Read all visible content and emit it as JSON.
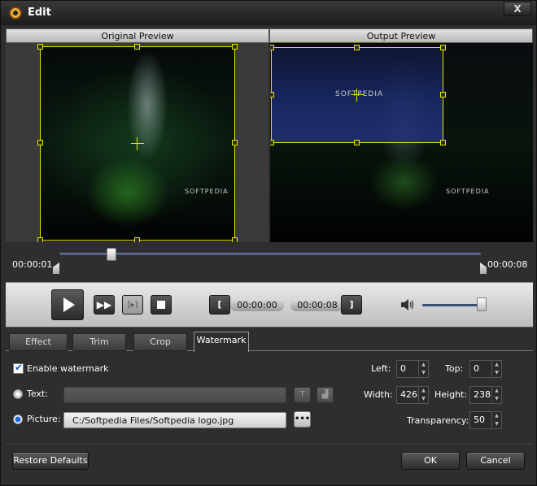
{
  "window": {
    "title": "Edit",
    "close_label": "X"
  },
  "preview": {
    "original_label": "Original Preview",
    "output_label": "Output Preview",
    "watermark_text": "SOFTPEDIA"
  },
  "timeline": {
    "start_time": "00:00:01",
    "end_time": "00:00:08",
    "position": 0.12
  },
  "controls": {
    "play_icon": "play-icon",
    "next_frame_icon": "fast-forward-icon",
    "trim_icon": "trim-icon",
    "stop_icon": "stop-icon",
    "mark_in_label": "[",
    "mark_out_label": "]",
    "start_time": "00:00:00",
    "end_time": "00:00:08",
    "volume": 0.95
  },
  "tabs": [
    {
      "label": "Effect"
    },
    {
      "label": "Trim"
    },
    {
      "label": "Crop"
    },
    {
      "label": "Watermark",
      "active": true
    }
  ],
  "watermark": {
    "enable_label": "Enable watermark",
    "enabled": true,
    "text_label": "Text:",
    "text_value": "",
    "picture_label": "Picture:",
    "picture_value": "C:/Softpedia Files/Softpedia logo.jpg",
    "browse_label": "•••",
    "left_label": "Left:",
    "left_value": "0",
    "top_label": "Top:",
    "top_value": "0",
    "width_label": "Width:",
    "width_value": "426",
    "height_label": "Height:",
    "height_value": "238",
    "transparency_label": "Transparency:",
    "transparency_value": "50"
  },
  "footer": {
    "restore_label": "Restore Defaults",
    "ok_label": "OK",
    "cancel_label": "Cancel"
  },
  "colors": {
    "selection": "#e6e600",
    "accent": "#1a6ad6",
    "track": "#3b4d75"
  }
}
